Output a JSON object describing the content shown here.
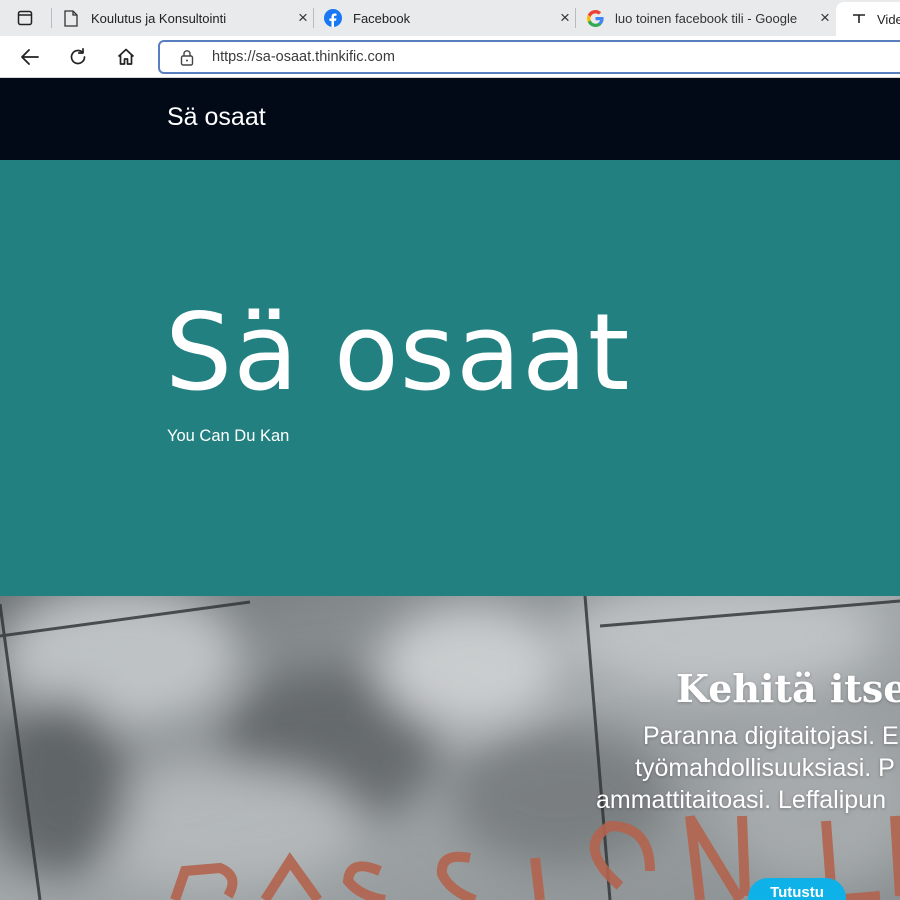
{
  "tabs": [
    {
      "title": "Koulutus ja Konsultointi",
      "icon": "document-icon"
    },
    {
      "title": "Facebook",
      "icon": "facebook-icon"
    },
    {
      "title": "luo toinen facebook tili - Google",
      "icon": "google-icon"
    },
    {
      "title": "Vide",
      "icon": "video-icon"
    }
  ],
  "address": {
    "url": "https://sa-osaat.thinkific.com"
  },
  "site": {
    "brand": "Sä osaat"
  },
  "hero": {
    "title": "Sä osaat",
    "subtitle": "You Can Du Kan"
  },
  "banner": {
    "title": "Kehitä itseäs",
    "lines": [
      "Paranna digitaitojasi. E",
      "työmahdollisuuksiasi. P",
      "ammattitaitoasi. Leffalipun"
    ],
    "button_label": "Tutustu",
    "background_text": "PASSION LED"
  },
  "colors": {
    "header": "#020a18",
    "hero": "#228080",
    "button": "#0fb1e9"
  }
}
